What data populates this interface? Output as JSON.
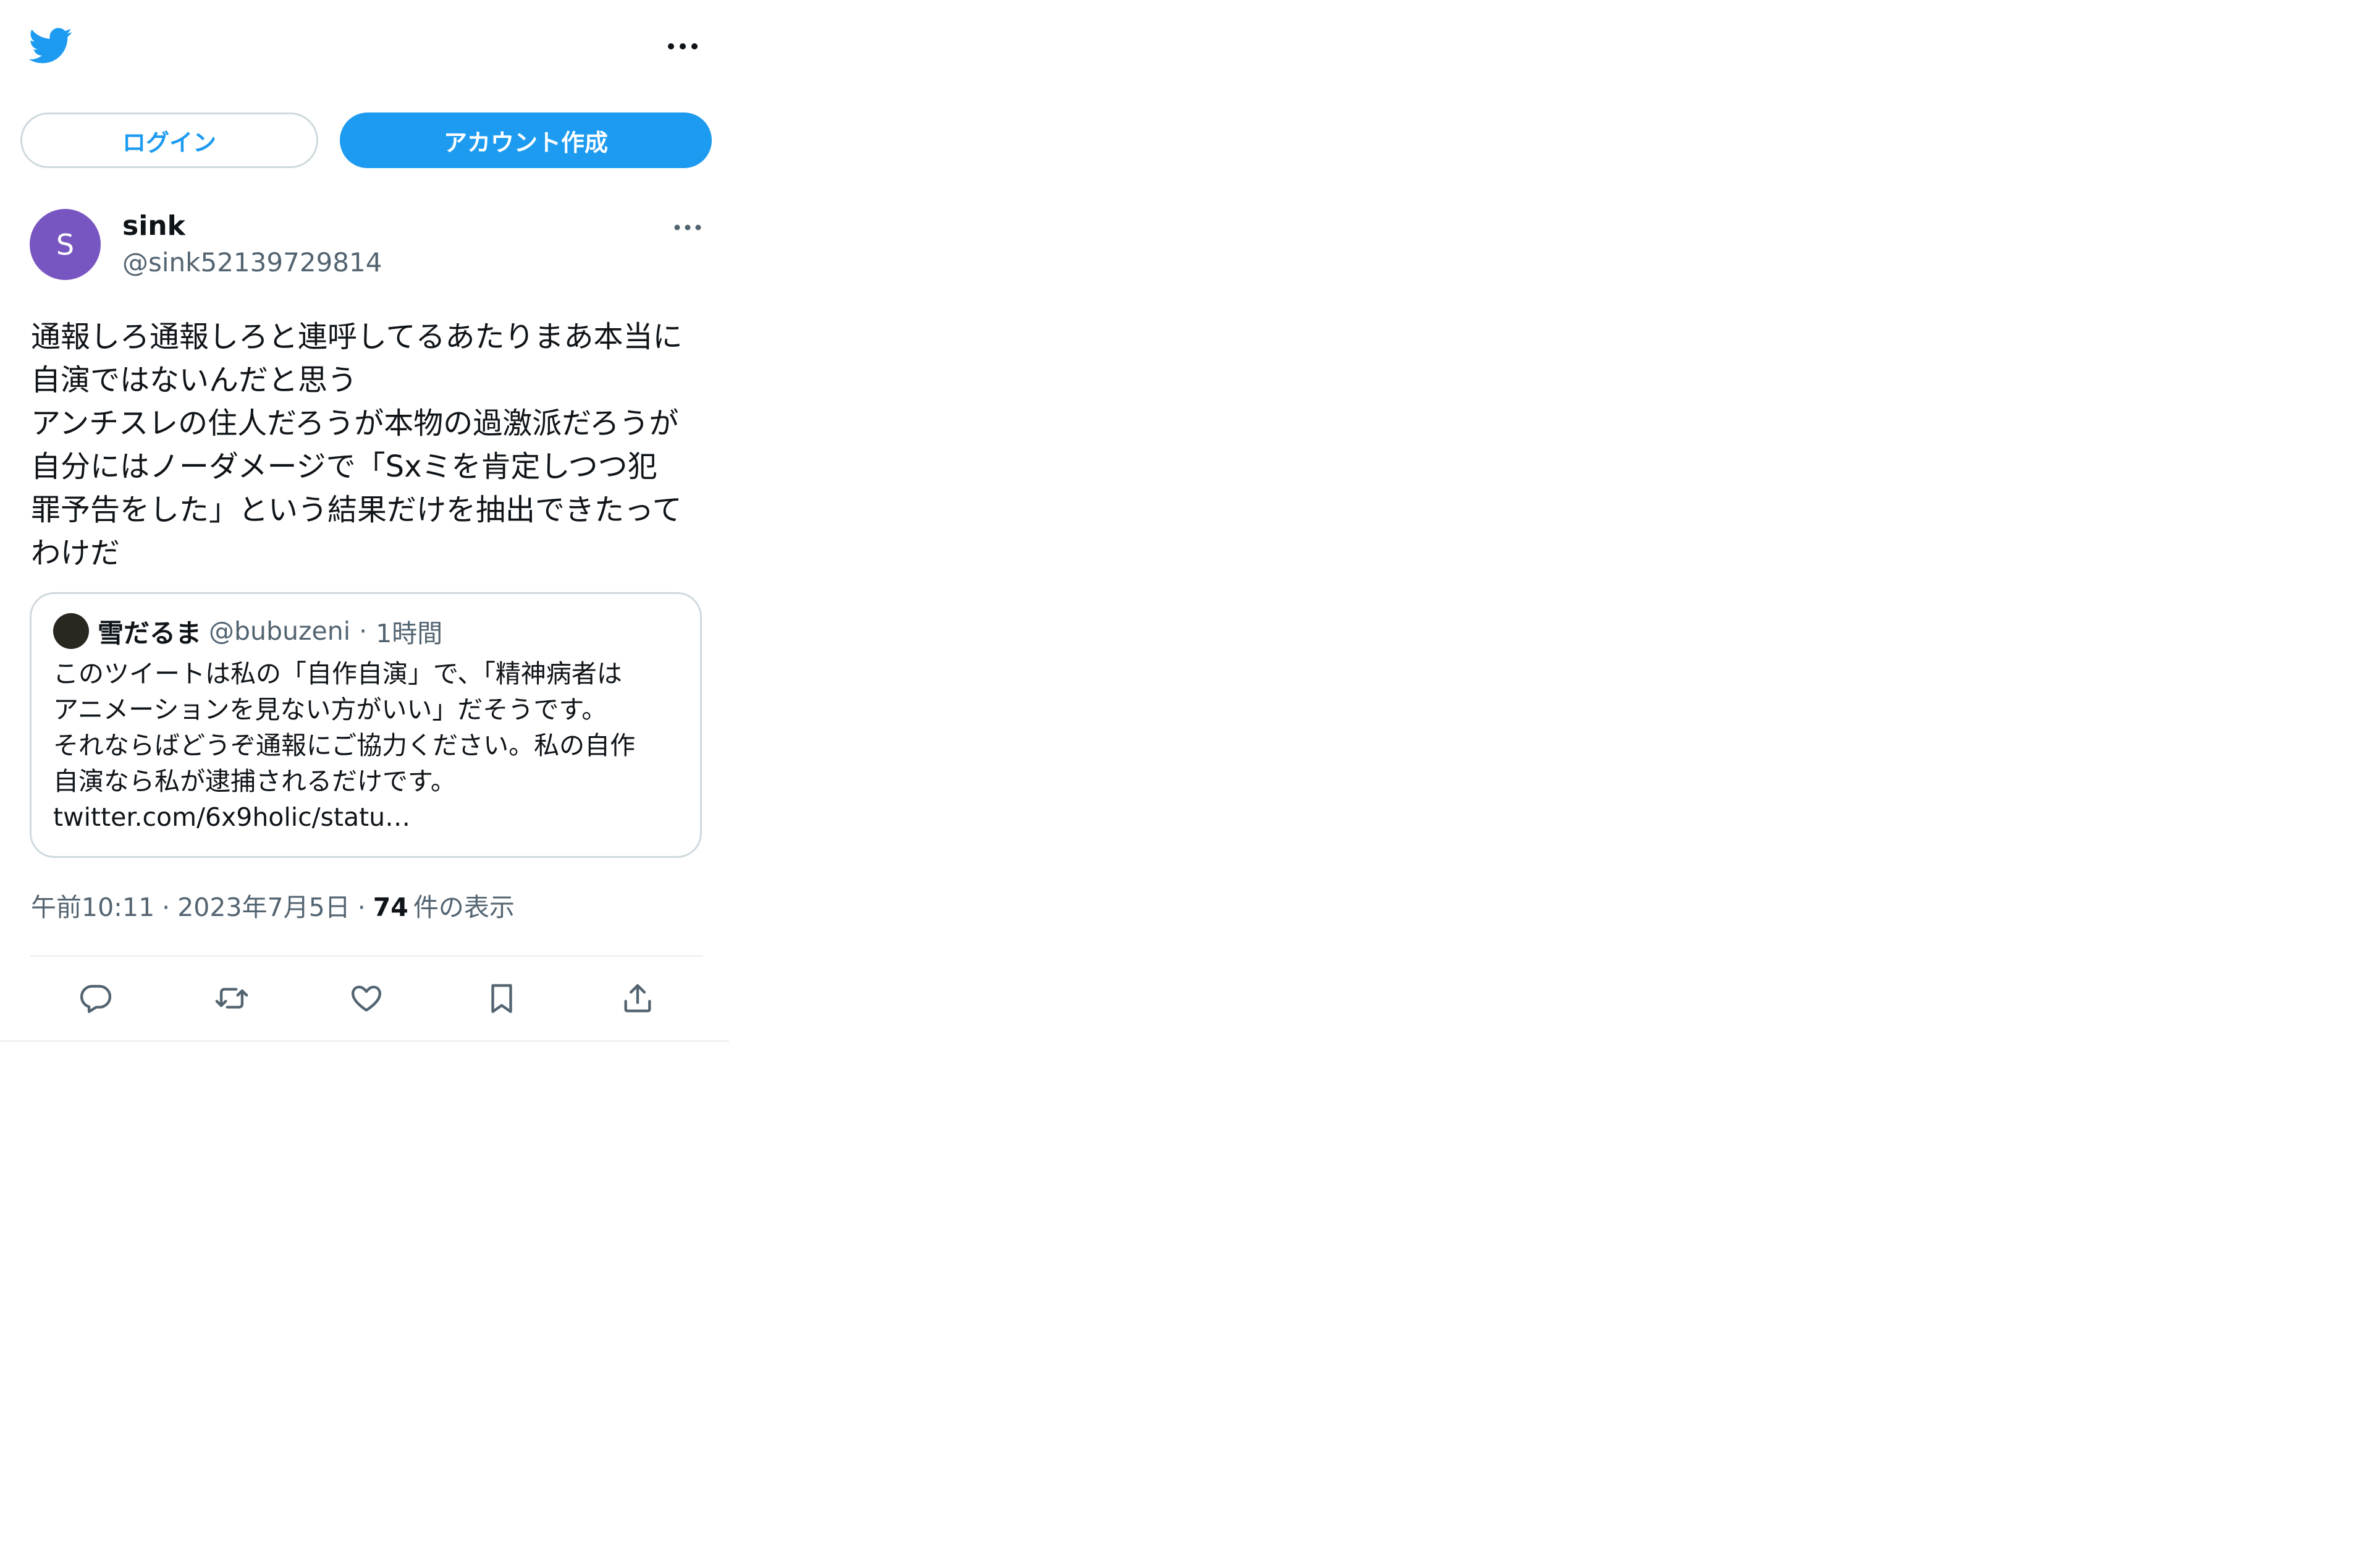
{
  "colors": {
    "brand_blue": "#1d9bf0",
    "avatar_purple": "#7856c1",
    "text_primary": "#0f1419",
    "text_secondary": "#536471",
    "border": "#cfd9de"
  },
  "header": {
    "logo_icon": "twitter-bird-icon",
    "more_icon": "more-horizontal-icon"
  },
  "auth": {
    "login_label": "ログイン",
    "signup_label": "アカウント作成"
  },
  "tweet": {
    "avatar_letter": "S",
    "author_name": "sink",
    "author_handle": "@sink52139729814",
    "text": "通報しろ通報しろと連呼してるあたりまあ本当に\n自演ではないんだと思う\nアンチスレの住人だろうが本物の過激派だろうが\n自分にはノーダメージで「Sxミを肯定しつつ犯\n罪予告をした」という結果だけを抽出できたって\nわけだ",
    "quote": {
      "author_name": "雪だるま",
      "author_handle": "@bubuzeni",
      "separator": "·",
      "time": "1時間",
      "text": "このツイートは私の「自作自演」で、「精神病者は\nアニメーションを見ない方がいい」だそうです。\nそれならばどうぞ通報にご協力ください。私の自作\n自演なら私が逮捕されるだけです。\ntwitter.com/6x9holic/statu…"
    },
    "meta": {
      "time": "午前10:11",
      "dot1": "·",
      "date": "2023年7月5日",
      "dot2": "·",
      "view_count": "74",
      "view_label": "件の表示"
    },
    "actions": {
      "reply_icon": "reply-icon",
      "retweet_icon": "retweet-icon",
      "like_icon": "like-icon",
      "bookmark_icon": "bookmark-icon",
      "share_icon": "share-icon"
    }
  }
}
